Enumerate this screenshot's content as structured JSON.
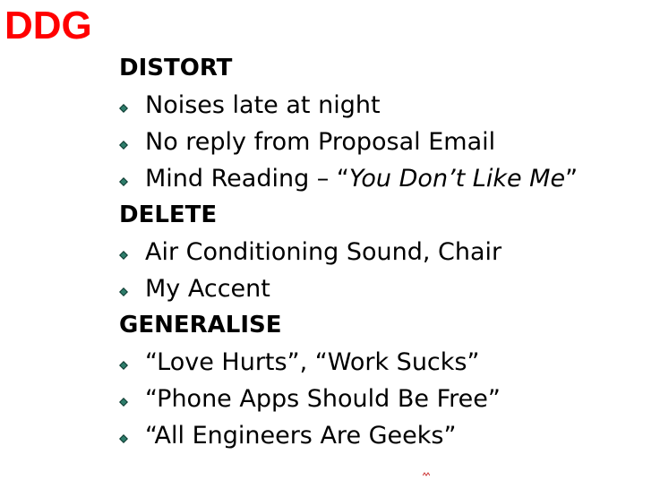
{
  "title": "DDG",
  "colors": {
    "title": "#ff0000",
    "bullet_fill": "#2e7d6b",
    "bullet_shadow": "#0c3a30"
  },
  "sections": [
    {
      "heading": "DISTORT",
      "items": [
        {
          "text": "Noises late at night"
        },
        {
          "text": "No reply from Proposal Email"
        },
        {
          "prefix": "Mind Reading – “",
          "emphasis": "You Don’t Like Me",
          "suffix": "”"
        }
      ]
    },
    {
      "heading": "DELETE",
      "items": [
        {
          "text": "Air Conditioning Sound, Chair"
        },
        {
          "text": "My Accent"
        }
      ]
    },
    {
      "heading": "GENERALISE",
      "items": [
        {
          "text": "“Love Hurts”, “Work Sucks”"
        },
        {
          "text": "“Phone Apps Should Be Free”"
        },
        {
          "text": "“All Engineers Are Geeks”"
        }
      ]
    }
  ]
}
